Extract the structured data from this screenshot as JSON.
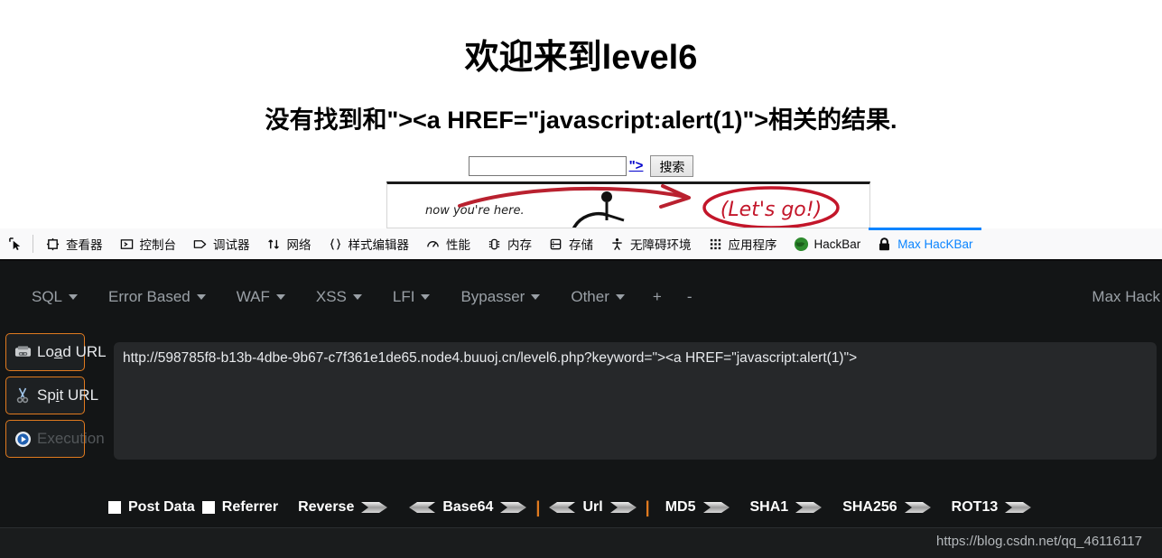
{
  "page": {
    "title": "欢迎来到level6",
    "subtitle": "没有找到和\"><a HREF=\"javascript:alert(1)\">相关的结果.",
    "search": {
      "value": "",
      "placeholder": "",
      "injected_link_text": "\">",
      "button_label": "搜索"
    },
    "illustration": {
      "caption": "now you're here.",
      "annotation": "(Let's go!)",
      "annotation_color": "#c3162a"
    }
  },
  "devtools": {
    "picker_icon": "element-picker-icon",
    "tabs": [
      {
        "label": "查看器",
        "icon": "inspector-icon",
        "active": false
      },
      {
        "label": "控制台",
        "icon": "console-icon",
        "active": false
      },
      {
        "label": "调试器",
        "icon": "debugger-icon",
        "active": false
      },
      {
        "label": "网络",
        "icon": "network-icon",
        "active": false
      },
      {
        "label": "样式编辑器",
        "icon": "style-editor-icon",
        "active": false
      },
      {
        "label": "性能",
        "icon": "performance-icon",
        "active": false
      },
      {
        "label": "内存",
        "icon": "memory-icon",
        "active": false
      },
      {
        "label": "存储",
        "icon": "storage-icon",
        "active": false
      },
      {
        "label": "无障碍环境",
        "icon": "accessibility-icon",
        "active": false
      },
      {
        "label": "应用程序",
        "icon": "application-icon",
        "active": false
      },
      {
        "label": "HackBar",
        "icon": "hackbar-globe-icon",
        "active": false
      },
      {
        "label": "Max HacKBar",
        "icon": "lock-icon",
        "active": true
      }
    ],
    "active_tab_color": "#0a84ff"
  },
  "hackbar": {
    "menu": [
      {
        "label": "SQL",
        "has_caret": true
      },
      {
        "label": "Error Based",
        "has_caret": true
      },
      {
        "label": "WAF",
        "has_caret": true
      },
      {
        "label": "XSS",
        "has_caret": true
      },
      {
        "label": "LFI",
        "has_caret": true
      },
      {
        "label": "Bypasser",
        "has_caret": true
      },
      {
        "label": "Other",
        "has_caret": true
      },
      {
        "label": "+",
        "has_caret": false
      },
      {
        "label": "-",
        "has_caret": false
      }
    ],
    "brand": "Max Hack",
    "buttons": [
      {
        "name": "load-url",
        "prefix": "Lo",
        "underline": "a",
        "suffix": "d URL",
        "icon": "load-url-icon",
        "disabled": false
      },
      {
        "name": "spit-url",
        "prefix": "Sp",
        "underline": "i",
        "suffix": "t URL",
        "icon": "scissors-icon",
        "disabled": false
      },
      {
        "name": "execution",
        "prefix": "Executio",
        "underline": "",
        "suffix": "n",
        "icon": "play-icon",
        "disabled": true
      }
    ],
    "url_value": "http://598785f8-b13b-4dbe-9b67-c7f361e1de65.node4.buuoj.cn/level6.php?keyword=\"><a HREF=\"javascript:alert(1)\">",
    "url_placeholder": "",
    "encode_bar": {
      "post_data_label": "Post Data",
      "post_data_checked": false,
      "referrer_label": "Referrer",
      "referrer_checked": false,
      "reverse_label": "Reverse",
      "base64_label": "Base64",
      "url_label": "Url",
      "md5_label": "MD5",
      "sha1_label": "SHA1",
      "sha256_label": "SHA256",
      "rot13_label": "ROT13",
      "separator": "|"
    },
    "accent_color": "#e07a1f"
  },
  "watermark": "https://blog.csdn.net/qq_46116117"
}
